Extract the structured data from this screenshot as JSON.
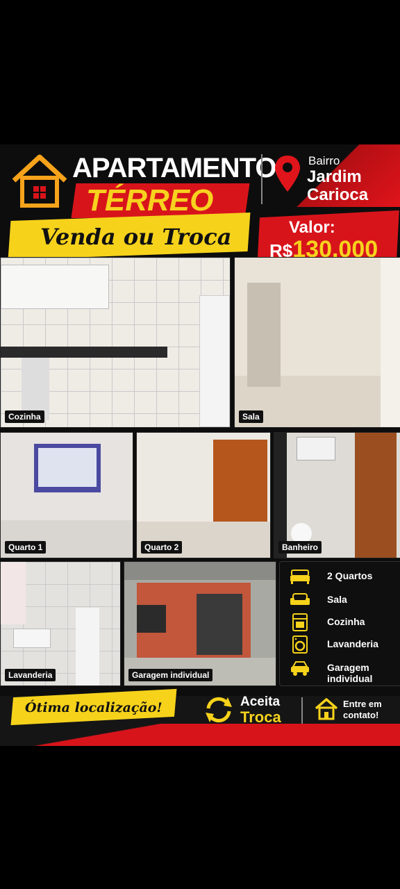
{
  "header": {
    "title": "APARTAMENTO",
    "subtitle": "TÉRREO",
    "offer": "Venda ou Troca",
    "location_label": "Bairro",
    "location_name": "Jardim Carioca",
    "price_label": "Valor:",
    "currency": "R$",
    "price": "130.000"
  },
  "photos": [
    {
      "label": "Cozinha"
    },
    {
      "label": "Sala"
    },
    {
      "label": "Quarto 1"
    },
    {
      "label": "Quarto 2"
    },
    {
      "label": "Banheiro"
    },
    {
      "label": "Lavanderia"
    },
    {
      "label": "Garagem individual"
    }
  ],
  "features": [
    {
      "icon": "bed-icon",
      "text": "2 Quartos"
    },
    {
      "icon": "sofa-icon",
      "text": "Sala"
    },
    {
      "icon": "stove-icon",
      "text": "Cozinha"
    },
    {
      "icon": "washing-machine-icon",
      "text": "Lavanderia"
    },
    {
      "icon": "car-icon",
      "text": "Garagem individual"
    }
  ],
  "footer": {
    "location_badge": "Ótima localização!",
    "accepts": "Aceita",
    "trade": "Troca",
    "contact": "Entre em contato!"
  },
  "colors": {
    "red": "#d8141b",
    "yellow": "#f6d21b",
    "dark": "#0d0d0d"
  }
}
